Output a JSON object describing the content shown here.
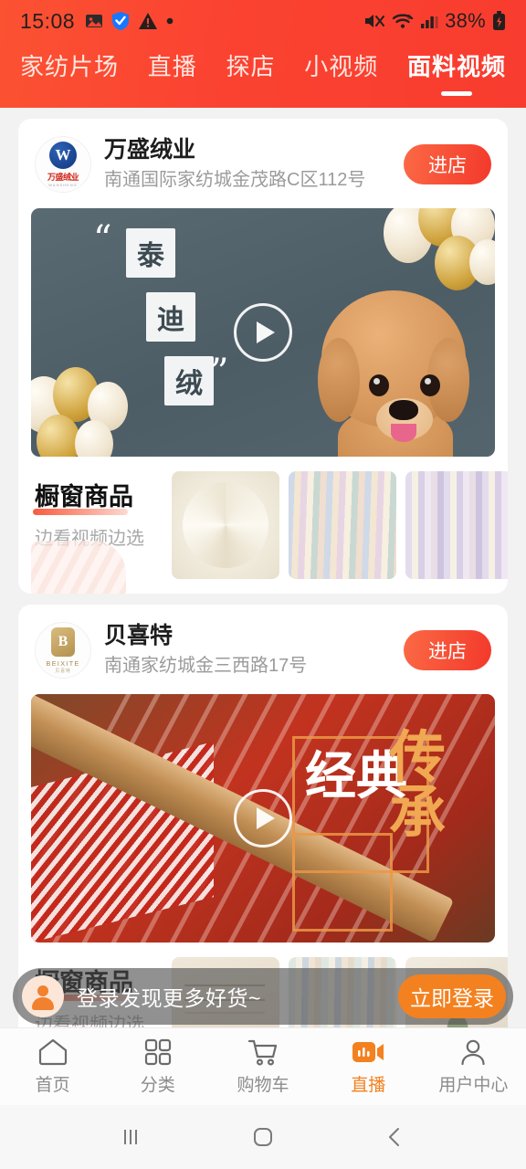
{
  "status_bar": {
    "time": "15:08",
    "battery_percent": "38%",
    "left_icons": [
      "image-icon",
      "shield-check-icon",
      "warning-triangle-icon",
      "dot-icon"
    ],
    "right_icons": [
      "mute-icon",
      "wifi-icon",
      "signal-icon",
      "battery-charging-icon"
    ]
  },
  "tabs": [
    {
      "label": "家纺片场",
      "active": false
    },
    {
      "label": "直播",
      "active": false
    },
    {
      "label": "探店",
      "active": false
    },
    {
      "label": "小视频",
      "active": false
    },
    {
      "label": "面料视频",
      "active": true
    }
  ],
  "cards": [
    {
      "shop_name": "万盛绒业",
      "shop_address": "南通国际家纺城金茂路C区112号",
      "enter_label": "进店",
      "logo_text": "万盛绒业",
      "logo_sub": "WANSHENG",
      "logo_letter": "W",
      "video_caption": [
        "泰",
        "迪",
        "绒"
      ],
      "showcase_title": "橱窗商品",
      "showcase_subtitle": "边看视频边选"
    },
    {
      "shop_name": "贝喜特",
      "shop_address": "南通家纺城金三西路17号",
      "enter_label": "进店",
      "logo_text": "BEIXITE",
      "logo_sub": "贝喜特",
      "logo_letter": "B",
      "video_caption": [
        "经典",
        "传承"
      ],
      "showcase_title": "橱窗商品",
      "showcase_subtitle": "边看视频边选"
    }
  ],
  "login_banner": {
    "message": "登录发现更多好货~",
    "button_label": "立即登录"
  },
  "bottom_nav": [
    {
      "label": "首页",
      "icon": "home-icon",
      "active": false
    },
    {
      "label": "分类",
      "icon": "grid-icon",
      "active": false
    },
    {
      "label": "购物车",
      "icon": "cart-icon",
      "active": false
    },
    {
      "label": "直播",
      "icon": "live-video-icon",
      "active": true
    },
    {
      "label": "用户中心",
      "icon": "user-icon",
      "active": false
    }
  ],
  "system_nav": [
    "recents-button",
    "home-button",
    "back-button"
  ],
  "colors": {
    "brand_red": "#fb4331",
    "accent_orange": "#f4811f",
    "enter_button": "#f3382b",
    "page_bg": "#f2f2f2"
  }
}
